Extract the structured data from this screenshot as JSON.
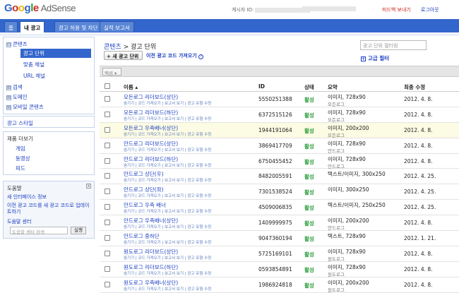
{
  "header": {
    "logo_google": [
      "G",
      "o",
      "o",
      "g",
      "l",
      "e"
    ],
    "logo_product": "AdSense",
    "account_label": "게시자 ID:",
    "feedback": "피드백 보내기",
    "logout": "로그아웃"
  },
  "tabs": [
    {
      "label": "홈"
    },
    {
      "label": "내 광고",
      "active": true
    },
    {
      "label": "광고 허용 및 차단"
    },
    {
      "label": "실적 보고서"
    }
  ],
  "sidebar": {
    "nav": [
      {
        "label": "콘텐츠",
        "toggle": "⊟"
      },
      {
        "label": "광고 단위",
        "selected": true
      },
      {
        "label": "맞춤 채널"
      },
      {
        "label": "URL 채널"
      },
      {
        "label": "검색",
        "toggle": "⊞"
      },
      {
        "label": "도메인",
        "toggle": "⊞"
      },
      {
        "label": "모바일 콘텐츠",
        "toggle": "⊞"
      }
    ],
    "ad_style": "광고 스타일",
    "more": {
      "title": "제품 더보기",
      "items": [
        "게임",
        "동영상",
        "피드"
      ]
    },
    "help": {
      "title": "도움말",
      "close": "x",
      "links": [
        "새 인터페이스 정보",
        "이전 광고 코드를 새 광고 코드로 업데이트하기"
      ],
      "center": "도움말 센터",
      "search_placeholder": "도움말 센터 검색",
      "search_button": "실행"
    }
  },
  "main": {
    "breadcrumb_root": "콘텐츠",
    "breadcrumb_sep": ">",
    "breadcrumb_current": "광고 단위",
    "filter_placeholder": "광고 단위 필터링",
    "new_button": "+ 새 광고 단위",
    "get_code": "이전 광고 코드 가져오기",
    "advanced_filter": "고급 필터",
    "action_button": "액션 ▾",
    "columns": {
      "name": "이름 ▴",
      "id": "ID",
      "status": "상태",
      "summary": "요약",
      "modified": "최종 수정"
    },
    "row_sub": "숨기기 | 코드 가져오기 | 보고서 보기 | 광고 유형 수정",
    "rows": [
      {
        "name": "모든로그 리더보드(상단)",
        "id": "5550251388",
        "status": "활성",
        "summary": "이미지, 728x90",
        "summary2": "모든로그",
        "date": "2012. 4. 8."
      },
      {
        "name": "모든로그 리더보드(하단)",
        "id": "6372515126",
        "status": "활성",
        "summary": "이미지, 728x90",
        "summary2": "모든로그",
        "date": "2012. 4. 8."
      },
      {
        "name": "모든로그 우측배너(상단)",
        "id": "1944191064",
        "status": "활성",
        "summary": "이미지, 200x200",
        "summary2": "모든로그",
        "date": "2012. 4. 8.",
        "highlight": true
      },
      {
        "name": "안드로그 리더보드(상단)",
        "id": "3869417709",
        "status": "활성",
        "summary": "이미지, 728x90",
        "summary2": "안드로그",
        "date": "2012. 4. 8."
      },
      {
        "name": "안드로그 리더보드(하단)",
        "id": "6750455452",
        "status": "활성",
        "summary": "이미지, 728x90",
        "summary2": "안드로그",
        "date": "2012. 4. 8."
      },
      {
        "name": "안드로그 상단(우)",
        "id": "8482005591",
        "status": "활성",
        "summary": "텍스트/이미지, 300x250",
        "summary2": "",
        "date": "2012. 4. 25."
      },
      {
        "name": "안드로그 상단(좌)",
        "id": "7301538524",
        "status": "활성",
        "summary": "이미지, 300x250",
        "summary2": "",
        "date": "2012. 4. 25."
      },
      {
        "name": "안드로그 우측 배너",
        "id": "4509006835",
        "status": "활성",
        "summary": "텍스트/이미지, 250x250",
        "summary2": "",
        "date": "2012. 4. 25."
      },
      {
        "name": "안드로그 우측배너(상단)",
        "id": "1409999975",
        "status": "활성",
        "summary": "이미지, 200x200",
        "summary2": "안드로그",
        "date": "2012. 4. 8."
      },
      {
        "name": "안드로그 중하단",
        "id": "9047360194",
        "status": "활성",
        "summary": "텍스트, 728x90",
        "summary2": "",
        "date": "2012. 1. 21."
      },
      {
        "name": "원도로그 리더보드(상단)",
        "id": "5725169101",
        "status": "활성",
        "summary": "이미지, 728x90",
        "summary2": "원도로그",
        "date": "2012. 4. 8."
      },
      {
        "name": "원도로그 리더보드(하단)",
        "id": "0593854891",
        "status": "활성",
        "summary": "이미지, 728x90",
        "summary2": "원도로그",
        "date": "2012. 4. 8."
      },
      {
        "name": "원도로그 우측배너(상단)",
        "id": "1986924818",
        "status": "활성",
        "summary": "이미지, 200x200",
        "summary2": "원도로그",
        "date": "2012. 4. 8."
      }
    ]
  }
}
